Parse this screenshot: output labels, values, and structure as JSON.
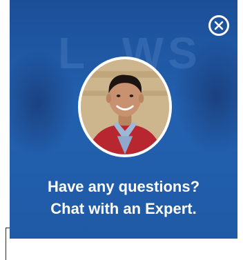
{
  "popup": {
    "headline_line1": "Have any questions?",
    "headline_line2": "Chat with an Expert.",
    "background_color": "#1f5aa6",
    "text_color": "#ffffff"
  },
  "icons": {
    "close": "close-circle-icon",
    "avatar": "expert-photo"
  }
}
